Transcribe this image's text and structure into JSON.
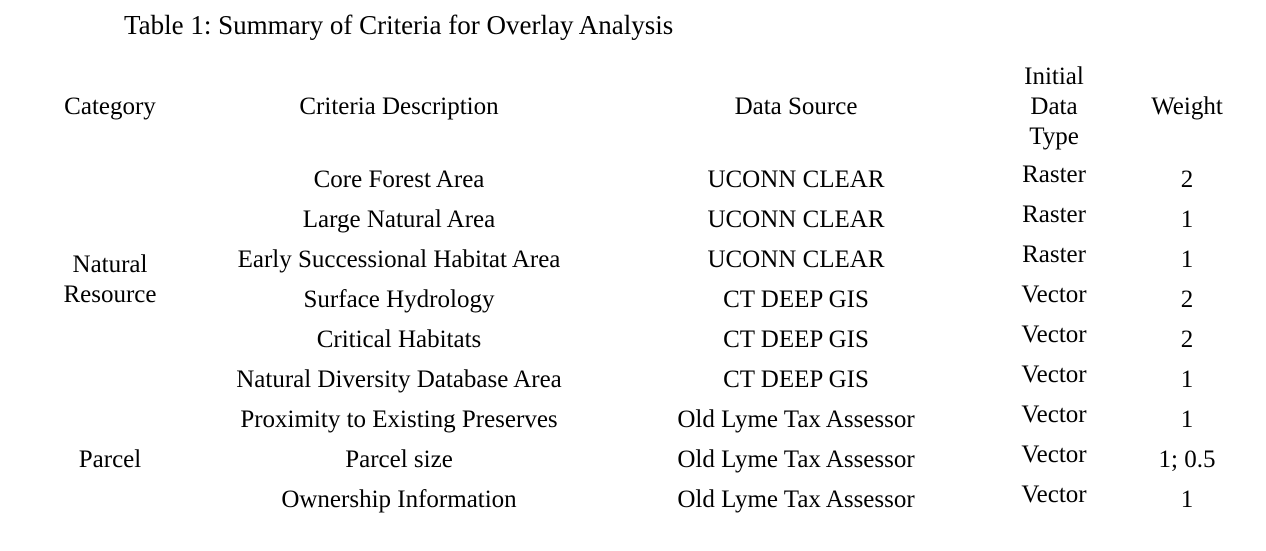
{
  "caption": "Table 1: Summary of Criteria for Overlay Analysis",
  "colors": {
    "text": "#000000",
    "background": "#ffffff",
    "rule": "#000000"
  },
  "table": {
    "headers": {
      "category": "Category",
      "criteria": "Criteria Description",
      "source": "Data Source",
      "type_line1": "Initial",
      "type_line2": "Data",
      "type_line3": "Type",
      "weight": "Weight"
    },
    "sections": [
      {
        "category_line1": "Natural",
        "category_line2": "Resource",
        "rows": [
          {
            "criteria": "Core Forest Area",
            "source": "UCONN CLEAR",
            "type": "Raster",
            "weight": "2"
          },
          {
            "criteria": "Large Natural Area",
            "source": "UCONN CLEAR",
            "type": "Raster",
            "weight": "1"
          },
          {
            "criteria": "Early Successional Habitat Area",
            "source": "UCONN CLEAR",
            "type": "Raster",
            "weight": "1"
          },
          {
            "criteria": "Surface Hydrology",
            "source": "CT DEEP GIS",
            "type": "Vector",
            "weight": "2"
          },
          {
            "criteria": "Critical Habitats",
            "source": "CT DEEP GIS",
            "type": "Vector",
            "weight": "2"
          },
          {
            "criteria": "Natural Diversity Database Area",
            "source": "CT DEEP GIS",
            "type": "Vector",
            "weight": "1"
          }
        ]
      },
      {
        "category_line1": "Parcel",
        "category_line2": "",
        "rows": [
          {
            "criteria": "Proximity to Existing Preserves",
            "source": "Old Lyme Tax Assessor",
            "type": "Vector",
            "weight": "1"
          },
          {
            "criteria": "Parcel size",
            "source": "Old Lyme Tax Assessor",
            "type": "Vector",
            "weight": "1; 0.5"
          },
          {
            "criteria": "Ownership Information",
            "source": "Old Lyme Tax Assessor",
            "type": "Vector",
            "weight": "1"
          }
        ]
      }
    ]
  }
}
